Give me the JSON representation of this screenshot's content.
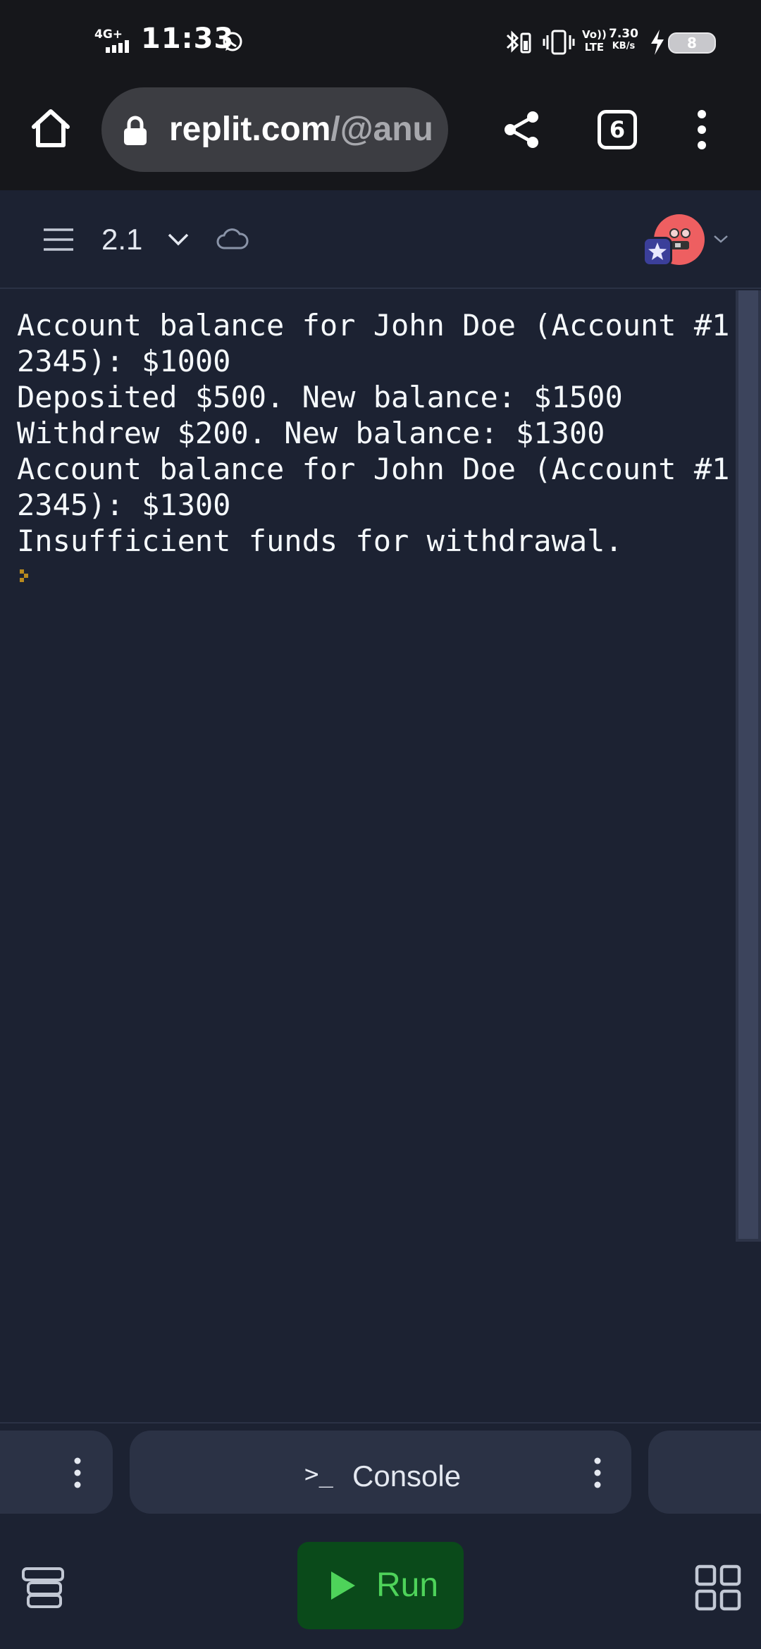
{
  "status_bar": {
    "network": "4G+",
    "time": "11:33",
    "volte_top": "Vo))",
    "volte_bottom": "LTE",
    "speed_value": "7.30",
    "speed_unit": "KB/s",
    "battery": "8"
  },
  "browser": {
    "url_domain": "replit.com",
    "url_path": "/@anu",
    "tab_count": "6"
  },
  "app": {
    "project_name": "2.1"
  },
  "console": {
    "lines": [
      "Account balance for John Doe (Account #1",
      "2345): $1000",
      "Deposited $500. New balance: $1500",
      "Withdrew $200. New balance: $1300",
      "Account balance for John Doe (Account #1",
      "2345): $1300",
      "Insufficient funds for withdrawal."
    ]
  },
  "tabs": {
    "console_prompt": ">_",
    "console_label": "Console"
  },
  "bottom": {
    "run_label": "Run"
  },
  "colors": {
    "background": "#1c2232",
    "panel": "#2b3245",
    "run_bg": "#0a4a1a",
    "run_text": "#4ed35a",
    "avatar": "#ee5f61"
  }
}
